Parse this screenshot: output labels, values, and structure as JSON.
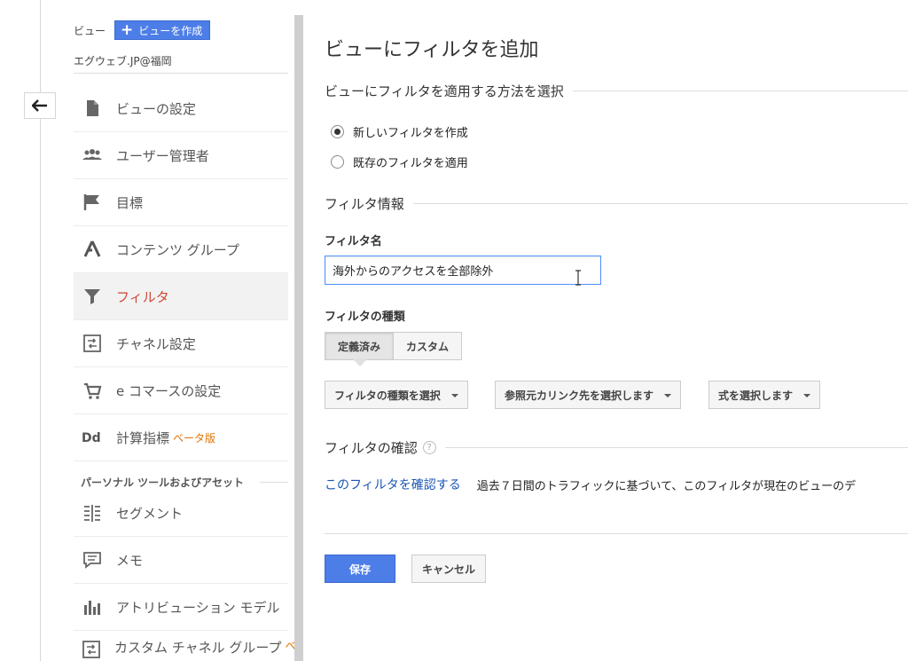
{
  "sidebar": {
    "view_label": "ビュー",
    "create_view_label": "ビューを作成",
    "account_name": "エグウェブ.JP@福岡",
    "items": [
      {
        "label": "ビューの設定",
        "icon": "document-icon"
      },
      {
        "label": "ユーザー管理者",
        "icon": "users-icon"
      },
      {
        "label": "目標",
        "icon": "flag-icon"
      },
      {
        "label": "コンテンツ グループ",
        "icon": "content-group-icon"
      },
      {
        "label": "フィルタ",
        "icon": "filter-icon",
        "active": true
      },
      {
        "label": "チャネル設定",
        "icon": "channel-icon"
      },
      {
        "label": "e コマースの設定",
        "icon": "cart-icon"
      },
      {
        "label": "計算指標",
        "icon": "dd-icon",
        "badge": "ベータ版"
      }
    ],
    "section_heading": "パーソナル ツールおよびアセット",
    "tools": [
      {
        "label": "セグメント",
        "icon": "segment-icon"
      },
      {
        "label": "メモ",
        "icon": "memo-icon"
      },
      {
        "label": "アトリビューション モデル",
        "icon": "attribution-icon"
      },
      {
        "label": "カスタム チャネル グループ",
        "icon": "custom-channel-icon",
        "badge": "ベ"
      }
    ]
  },
  "main": {
    "title": "ビューにフィルタを追加",
    "apply_method_heading": "ビューにフィルタを適用する方法を選択",
    "radio_new": "新しいフィルタを作成",
    "radio_existing": "既存のフィルタを適用",
    "filter_info_heading": "フィルタ情報",
    "filter_name_label": "フィルタ名",
    "filter_name_value": "海外からのアクセスを全部除外",
    "filter_type_label": "フィルタの種類",
    "tab_predefined": "定義済み",
    "tab_custom": "カスタム",
    "dropdown_type": "フィルタの種類を選択",
    "dropdown_source": "参照元カリンク先を選択します",
    "dropdown_expression": "式を選択します",
    "verify_heading": "フィルタの確認",
    "help_glyph": "?",
    "verify_link": "このフィルタを確認する",
    "verify_text": "過去７日間のトラフィックに基づいて、このフィルタが現在のビューのデ",
    "save_label": "保存",
    "cancel_label": "キャンセル"
  },
  "colors": {
    "accent": "#4d7ee8",
    "active_nav": "#d14836",
    "link": "#1a55b4",
    "beta": "#e37400"
  }
}
